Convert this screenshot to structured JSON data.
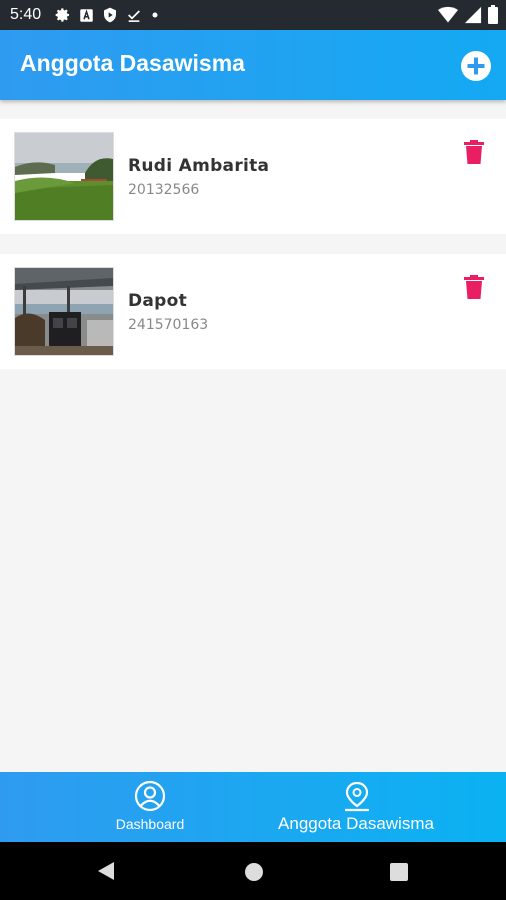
{
  "status_bar": {
    "time": "5:40",
    "icons": [
      "settings-icon",
      "a-box-icon",
      "shield-play-icon",
      "download-done-icon",
      "dot-icon",
      "wifi-icon",
      "signal-icon",
      "battery-icon"
    ]
  },
  "app_bar": {
    "title": "Anggota Dasawisma",
    "add_icon": "add-circle-icon"
  },
  "members": [
    {
      "name": "Rudi Ambarita",
      "id": "20132566",
      "photo": "lake-landscape-photo"
    },
    {
      "name": "Dapot",
      "id": "241570163",
      "photo": "terrace-lake-photo"
    }
  ],
  "bottom_nav": {
    "items": [
      {
        "label": "Dashboard",
        "icon": "person-circle-icon"
      },
      {
        "label": "Anggota Dasawisma",
        "icon": "location-pin-icon"
      }
    ]
  },
  "colors": {
    "primary": "#2196F3",
    "delete": "#E91E63",
    "statusbar": "#252A31"
  }
}
